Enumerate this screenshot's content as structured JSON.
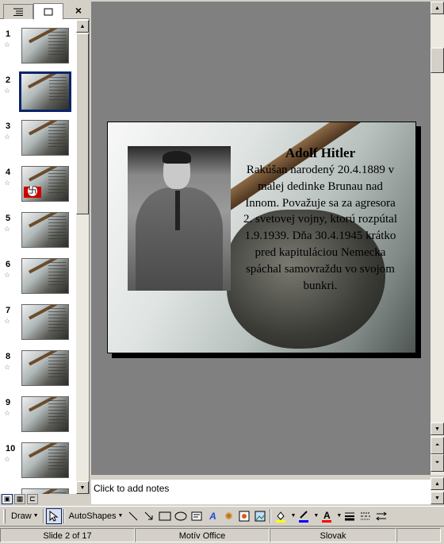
{
  "left_pane": {
    "tabs": [
      {
        "name": "outline"
      },
      {
        "name": "slides"
      }
    ],
    "close_label": "×",
    "thumbnails": [
      {
        "num": "1",
        "selected": false,
        "flag": false
      },
      {
        "num": "2",
        "selected": true,
        "flag": false
      },
      {
        "num": "3",
        "selected": false,
        "flag": false
      },
      {
        "num": "4",
        "selected": false,
        "flag": true
      },
      {
        "num": "5",
        "selected": false,
        "flag": false
      },
      {
        "num": "6",
        "selected": false,
        "flag": false
      },
      {
        "num": "7",
        "selected": false,
        "flag": false
      },
      {
        "num": "8",
        "selected": false,
        "flag": false
      },
      {
        "num": "9",
        "selected": false,
        "flag": false
      },
      {
        "num": "10",
        "selected": false,
        "flag": false
      },
      {
        "num": "",
        "selected": false,
        "flag": false
      }
    ]
  },
  "slide": {
    "title": "Adolf Hitler",
    "body": "Rakúšan narodený 20.4.1889 v malej dedinke Brunau nad Innom. Považuje sa za agresora 2. svetovej vojny, ktorú rozpútal 1.9.1939. Dňa 30.4.1945 krátko pred kapituláciou Nemecka spáchal samovraždu vo svojom bunkri."
  },
  "notes": {
    "placeholder": "Click to add notes"
  },
  "toolbar": {
    "draw_label": "Draw",
    "autoshapes_label": "AutoShapes",
    "icons": [
      "select-pointer-icon",
      "line-icon",
      "arrow-icon",
      "rectangle-icon",
      "oval-icon",
      "text-box-icon",
      "wordart-icon",
      "diagram-icon",
      "clip-art-icon",
      "picture-icon",
      "fill-color-icon",
      "line-color-icon",
      "font-color-icon",
      "line-style-icon",
      "dash-style-icon",
      "arrow-style-icon"
    ],
    "colors": {
      "fill": "#ffff00",
      "line": "#0000ff",
      "font": "#ff0000"
    }
  },
  "status": {
    "slide_info": "Slide 2 of 17",
    "theme": "Motív Office",
    "language": "Slovak"
  }
}
